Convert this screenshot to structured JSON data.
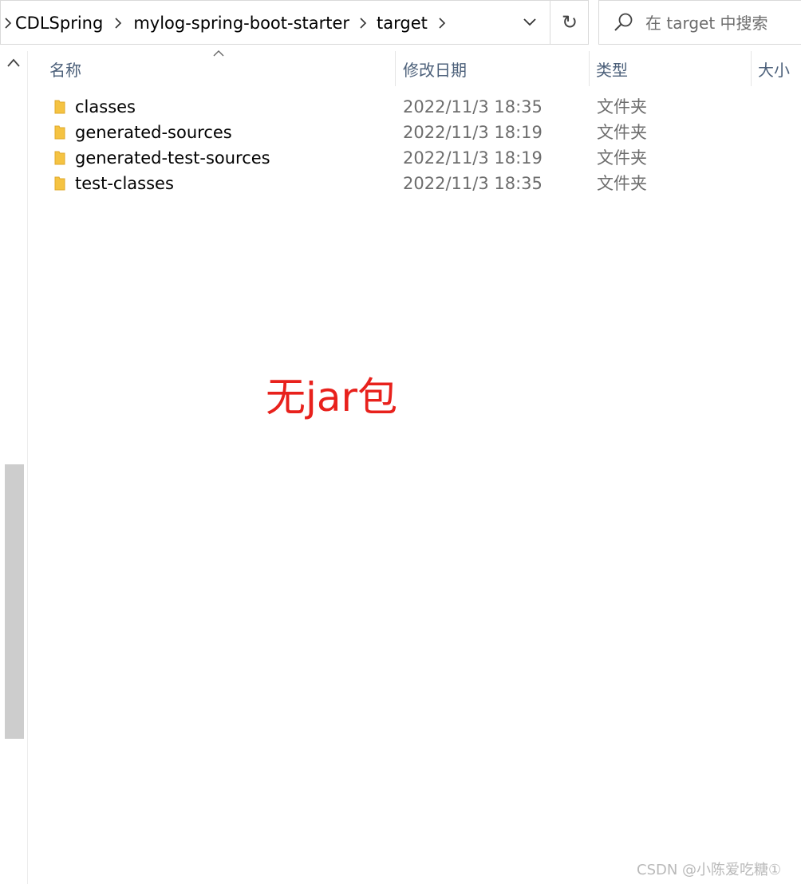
{
  "breadcrumb": {
    "items": [
      "CDLSpring",
      "mylog-spring-boot-starter",
      "target"
    ]
  },
  "search": {
    "placeholder": "在 target 中搜索"
  },
  "columns": {
    "name": "名称",
    "date": "修改日期",
    "type": "类型",
    "size": "大小"
  },
  "rows": [
    {
      "name": "classes",
      "date": "2022/11/3 18:35",
      "type": "文件夹"
    },
    {
      "name": "generated-sources",
      "date": "2022/11/3 18:19",
      "type": "文件夹"
    },
    {
      "name": "generated-test-sources",
      "date": "2022/11/3 18:19",
      "type": "文件夹"
    },
    {
      "name": "test-classes",
      "date": "2022/11/3 18:35",
      "type": "文件夹"
    }
  ],
  "annotation": "无jar包",
  "watermark": "CSDN @小陈爱吃糖①",
  "colors": {
    "accent_header": "#4c607a",
    "annotation": "#e8211c",
    "folder": "#f5c342"
  }
}
